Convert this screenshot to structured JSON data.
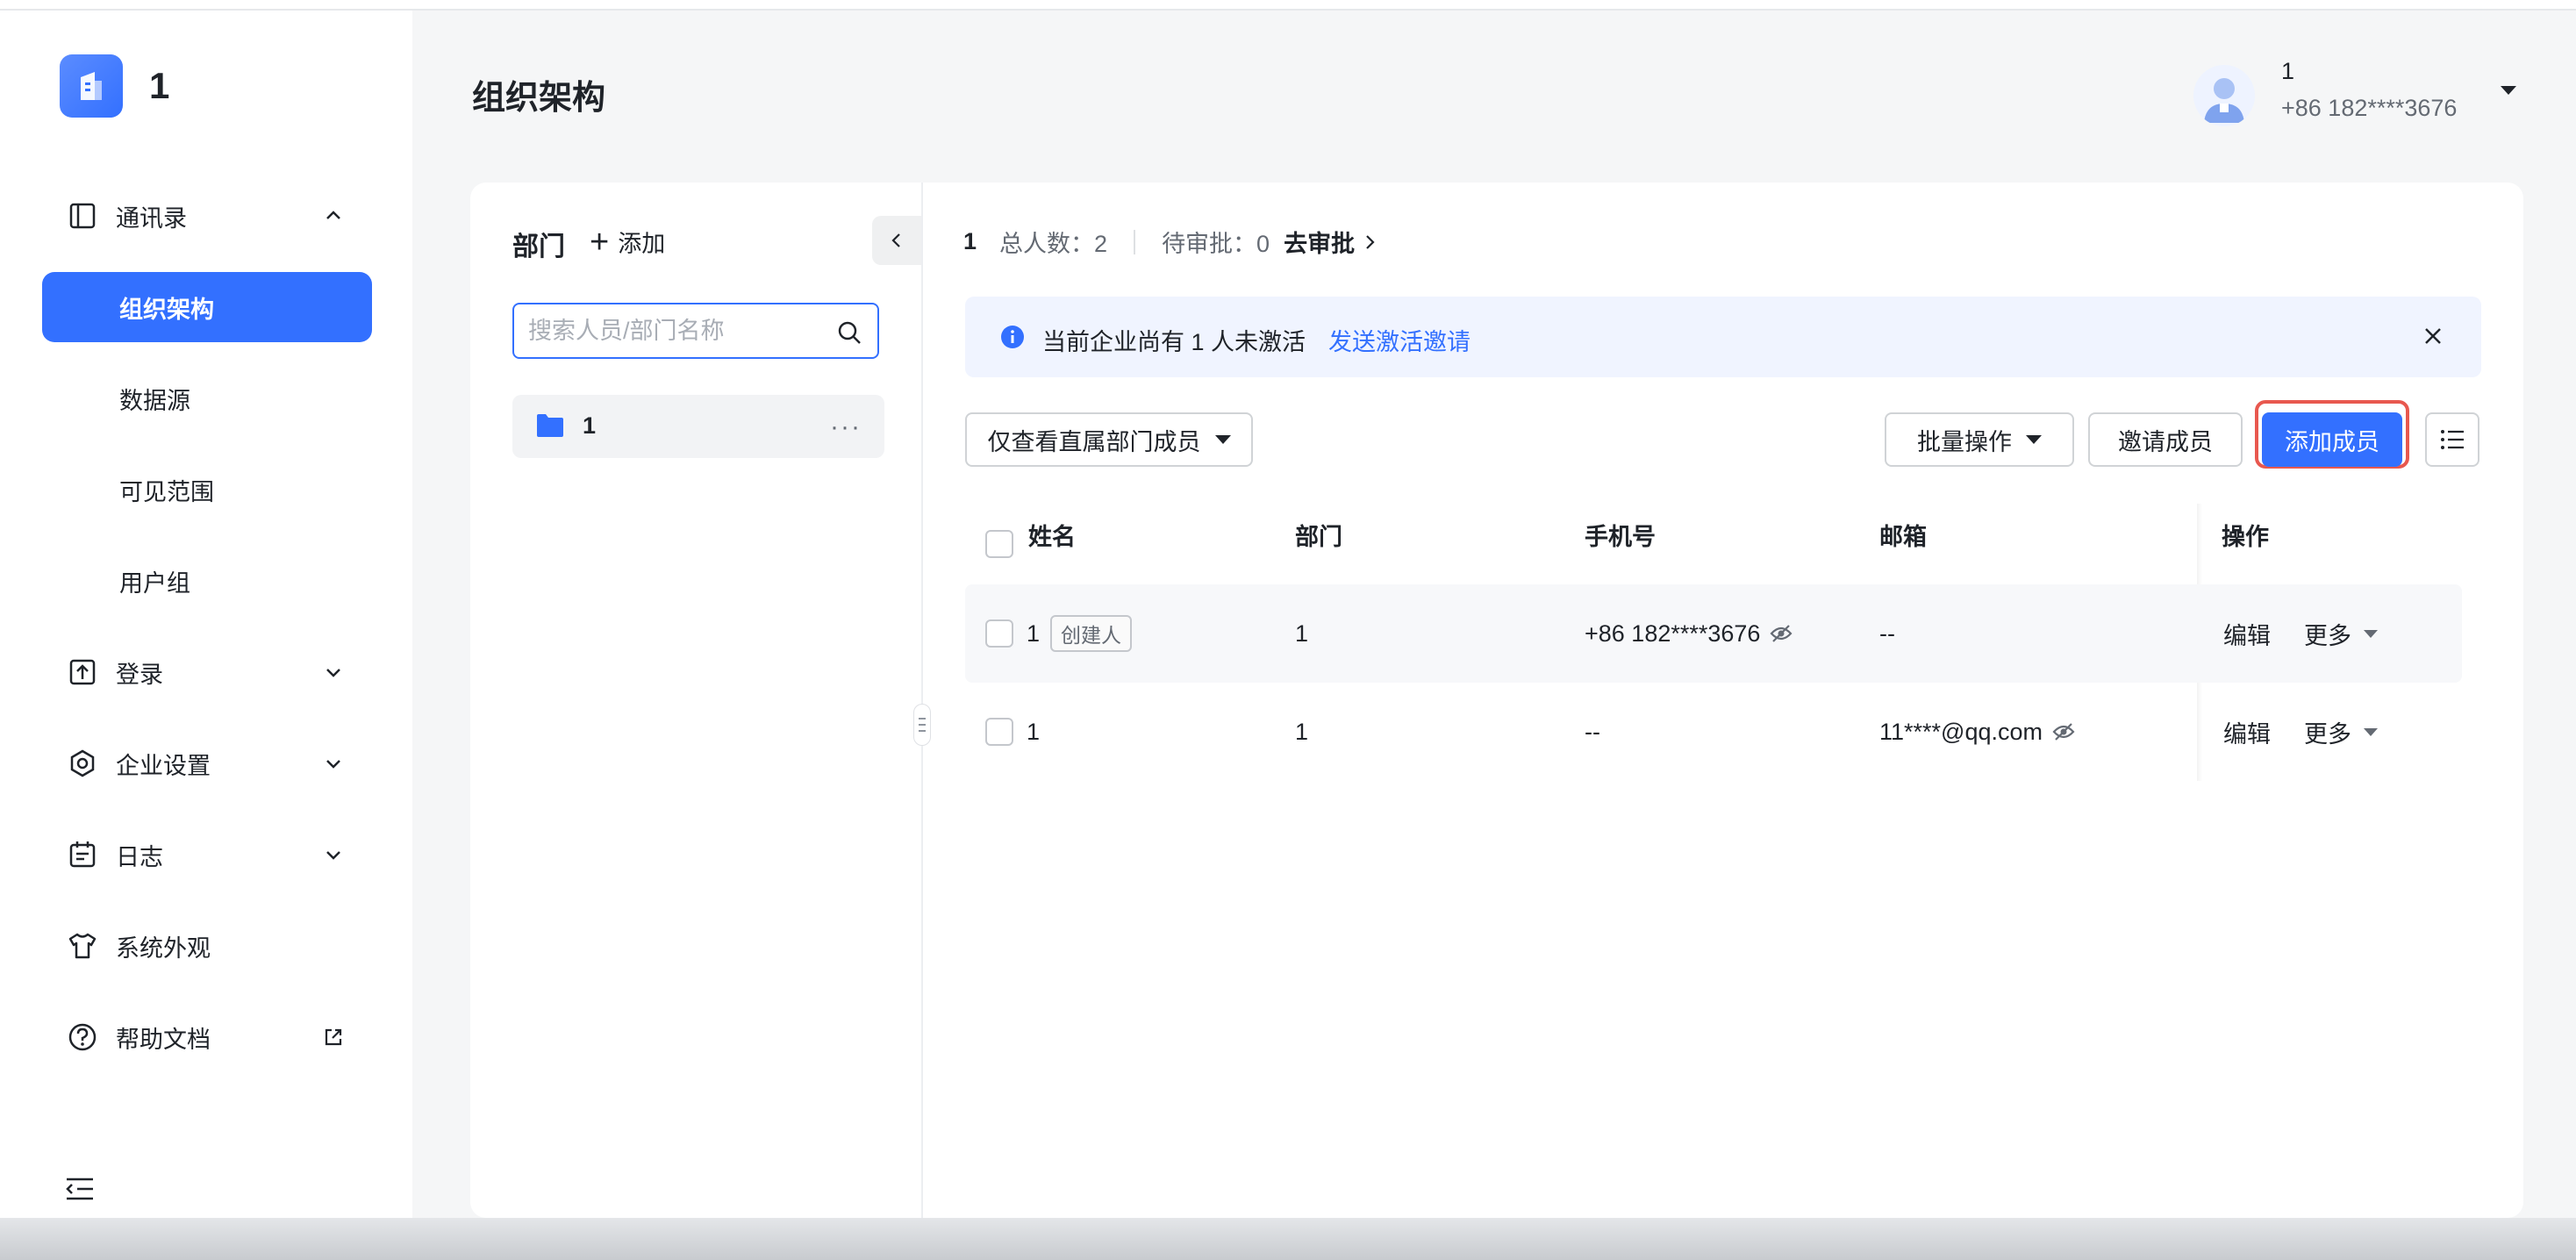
{
  "app": {
    "brand_name": "1",
    "page_title": "组织架构"
  },
  "user": {
    "name": "1",
    "phone": "+86 182****3676"
  },
  "sidebar": {
    "items": [
      {
        "label": "通讯录",
        "icon": "contacts-icon",
        "expanded": true
      },
      {
        "label": "组织架构",
        "active": true
      },
      {
        "label": "数据源"
      },
      {
        "label": "可见范围"
      },
      {
        "label": "用户组"
      },
      {
        "label": "登录",
        "icon": "login-icon"
      },
      {
        "label": "企业设置",
        "icon": "settings-icon"
      },
      {
        "label": "日志",
        "icon": "log-icon"
      },
      {
        "label": "系统外观",
        "icon": "shirt-icon"
      },
      {
        "label": "帮助文档",
        "icon": "help-icon"
      }
    ]
  },
  "departments": {
    "title": "部门",
    "add_label": "添加",
    "search_placeholder": "搜索人员/部门名称",
    "tree": [
      {
        "label": "1"
      }
    ]
  },
  "summary": {
    "dept_name": "1",
    "total_label": "总人数：2",
    "pending_label": "待审批：0",
    "review_link": "去审批"
  },
  "notice": {
    "text": "当前企业尚有 1 人未激活",
    "link": "发送激活邀请"
  },
  "toolbar": {
    "filter_label": "仅查看直属部门成员",
    "batch_label": "批量操作",
    "invite_label": "邀请成员",
    "add_label": "添加成员"
  },
  "table": {
    "columns": [
      "姓名",
      "部门",
      "手机号",
      "邮箱",
      "操作"
    ],
    "rows": [
      {
        "name": "1",
        "tag": "创建人",
        "dept": "1",
        "phone": "+86 182****3676",
        "email": "--",
        "edit": "编辑",
        "more": "更多"
      },
      {
        "name": "1",
        "tag": "",
        "dept": "1",
        "phone": "--",
        "email": "11****@qq.com",
        "edit": "编辑",
        "more": "更多"
      }
    ]
  },
  "colors": {
    "accent": "#3370ff",
    "highlight": "#e8584f"
  }
}
